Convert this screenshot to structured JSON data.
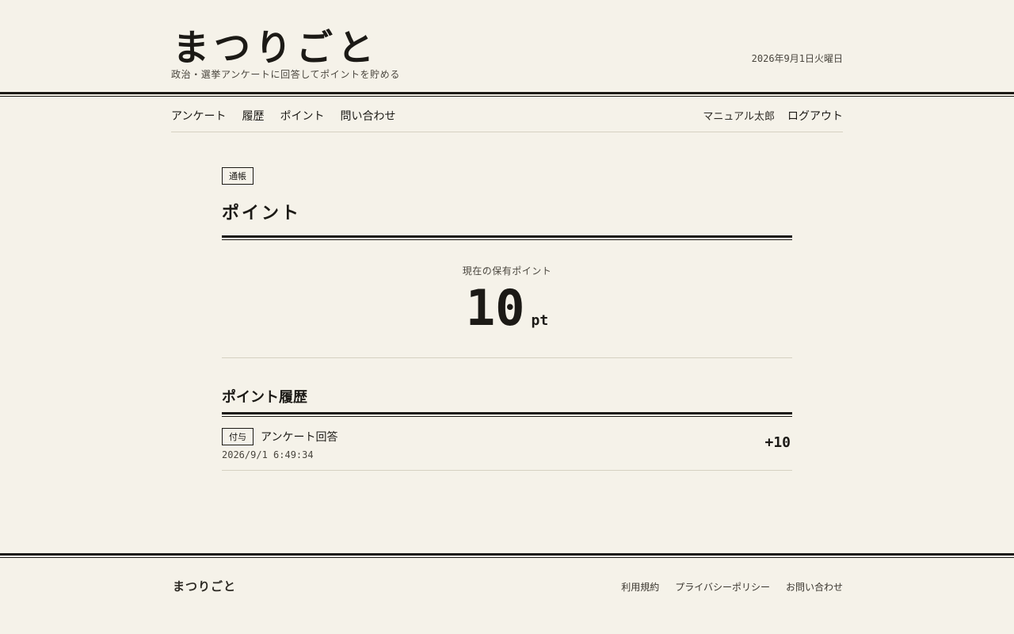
{
  "site": {
    "logo": "まつりごと",
    "tagline": "政治・選挙アンケートに回答してポイントを貯める",
    "date": "2026年9月1日火曜日"
  },
  "nav": {
    "items": [
      {
        "label": "アンケート"
      },
      {
        "label": "履歴"
      },
      {
        "label": "ポイント"
      },
      {
        "label": "問い合わせ"
      }
    ],
    "user_name": "マニュアル太郎",
    "logout": "ログアウト"
  },
  "page": {
    "tag": "通帳",
    "title": "ポイント",
    "balance_label": "現在の保有ポイント",
    "balance_value": "10",
    "balance_unit": "pt"
  },
  "history": {
    "title": "ポイント履歴",
    "rows": [
      {
        "type": "付与",
        "label": "アンケート回答",
        "timestamp": "2026/9/1 6:49:34",
        "amount": "+10"
      }
    ]
  },
  "footer": {
    "logo": "まつりごと",
    "links": [
      {
        "label": "利用規約"
      },
      {
        "label": "プライバシーポリシー"
      },
      {
        "label": "お問い合わせ"
      }
    ]
  },
  "colors": {
    "background": "#f5f2e9",
    "text": "#1c1a16",
    "muted": "#4a463e",
    "divider": "#d6d1c2"
  }
}
